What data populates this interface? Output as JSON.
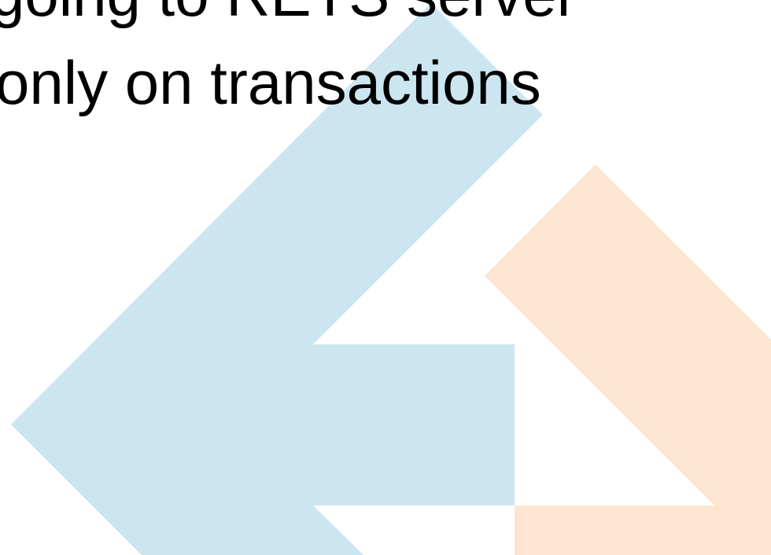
{
  "slide": {
    "text_lines": [
      "going to RETS server",
      "only on transactions"
    ]
  },
  "decoration": {
    "left_arrow_color": "#cce6f1",
    "right_arrow_color": "#fce6d2"
  }
}
